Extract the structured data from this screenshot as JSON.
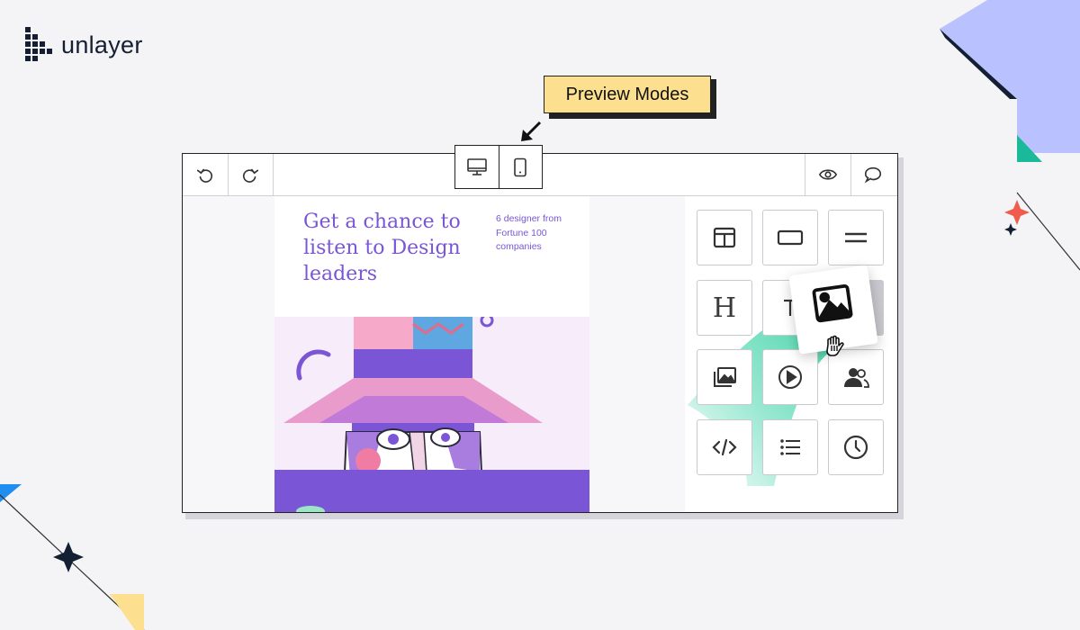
{
  "brand": {
    "name": "unlayer"
  },
  "callout": {
    "label": "Preview Modes"
  },
  "toolbar": {
    "left": [
      {
        "icon": "undo-icon"
      },
      {
        "icon": "redo-icon"
      }
    ],
    "preview_modes": [
      {
        "icon": "desktop-icon"
      },
      {
        "icon": "mobile-icon"
      }
    ],
    "right": [
      {
        "icon": "eye-icon"
      },
      {
        "icon": "comment-icon"
      }
    ]
  },
  "email": {
    "heading": "Get a chance to listen to Design leaders",
    "subheading": "6 designer from Fortune 100 companies"
  },
  "tools": [
    {
      "icon": "columns-icon"
    },
    {
      "icon": "button-icon"
    },
    {
      "icon": "divider-icon"
    },
    {
      "icon": "heading-icon",
      "text": "H"
    },
    {
      "icon": "text-icon"
    },
    {
      "icon": "html-icon"
    },
    {
      "icon": "carousel-icon"
    },
    {
      "icon": "video-icon"
    },
    {
      "icon": "social-icon"
    },
    {
      "icon": "code-icon"
    },
    {
      "icon": "menu-icon"
    },
    {
      "icon": "timer-icon"
    }
  ],
  "dragging": {
    "icon": "image-icon"
  },
  "colors": {
    "accent_purple": "#7a55d6",
    "callout_yellow": "#fce08f",
    "drag_green": "#2fd0a0",
    "deco_blue": "#b9c2ff",
    "deco_red": "#ef5b4d",
    "deco_teal": "#19b99a",
    "deco_navy": "#141f33"
  }
}
